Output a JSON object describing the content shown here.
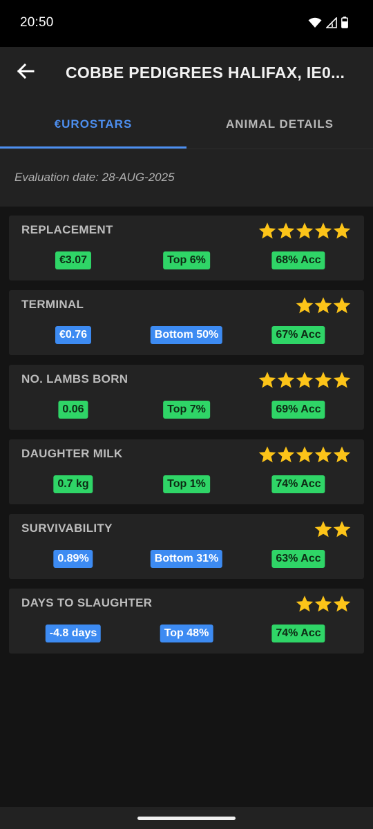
{
  "status_bar": {
    "time": "20:50",
    "icons": [
      "wifi-icon",
      "signal-icon",
      "battery-icon"
    ]
  },
  "app_bar": {
    "back_icon": "arrow-left-icon",
    "title": "COBBE PEDIGREES HALIFAX, IE0..."
  },
  "tabs": [
    {
      "label": "€UROSTARS",
      "active": true
    },
    {
      "label": "ANIMAL DETAILS",
      "active": false
    }
  ],
  "evaluation": {
    "text": "Evaluation date: 28-AUG-2025"
  },
  "colors": {
    "green_badge": "#2fd567",
    "blue_badge": "#3d8bf2",
    "star": "#fcc419",
    "accent": "#4d8ff0"
  },
  "traits": [
    {
      "name": "REPLACEMENT",
      "stars": 5,
      "value": "€3.07",
      "value_color": "green",
      "rank": "Top 6%",
      "rank_color": "green",
      "accuracy": "68% Acc"
    },
    {
      "name": "TERMINAL",
      "stars": 3,
      "value": "€0.76",
      "value_color": "blue",
      "rank": "Bottom 50%",
      "rank_color": "blue",
      "accuracy": "67% Acc"
    },
    {
      "name": "NO. LAMBS BORN",
      "stars": 5,
      "value": "0.06",
      "value_color": "green",
      "rank": "Top 7%",
      "rank_color": "green",
      "accuracy": "69% Acc"
    },
    {
      "name": "DAUGHTER MILK",
      "stars": 5,
      "value": "0.7 kg",
      "value_color": "green",
      "rank": "Top 1%",
      "rank_color": "green",
      "accuracy": "74% Acc"
    },
    {
      "name": "SURVIVABILITY",
      "stars": 2,
      "value": "0.89%",
      "value_color": "blue",
      "rank": "Bottom 31%",
      "rank_color": "blue",
      "accuracy": "63% Acc"
    },
    {
      "name": "DAYS TO SLAUGHTER",
      "stars": 3,
      "value": "-4.8 days",
      "value_color": "blue",
      "rank": "Top 48%",
      "rank_color": "blue",
      "accuracy": "74% Acc"
    }
  ]
}
